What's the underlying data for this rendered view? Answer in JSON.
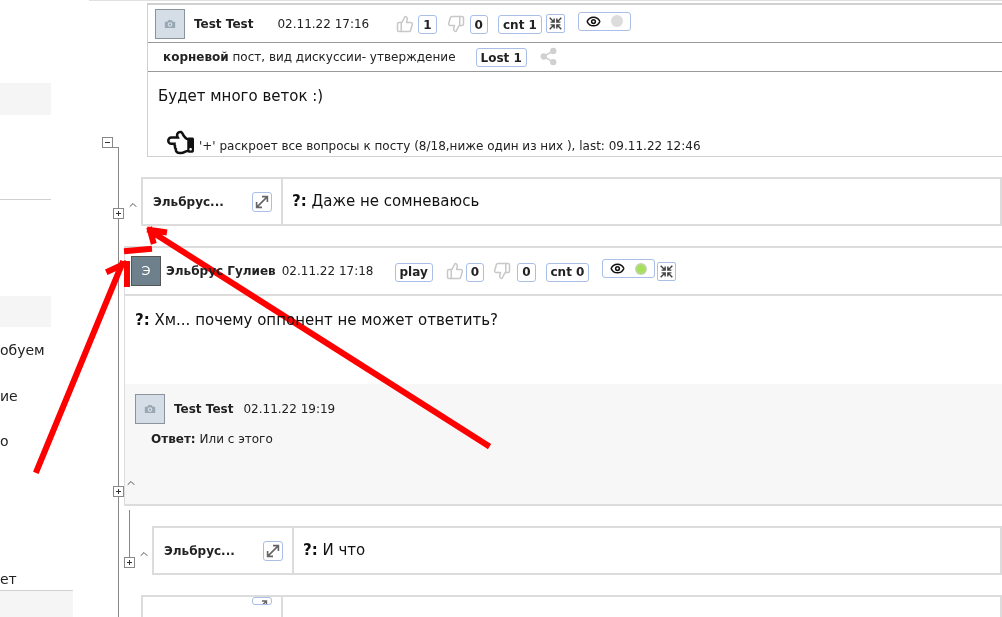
{
  "sidebar_fragments": [
    {
      "text": "обуем"
    },
    {
      "text": "ие"
    },
    {
      "text": "о"
    },
    {
      "text": "ет"
    }
  ],
  "root_post": {
    "expanded": true,
    "author": "Test Test",
    "date": "02.11.22 17:16",
    "likes": "1",
    "dislikes": "0",
    "count": "cnt 1",
    "seen": false,
    "type_label": "корневой",
    "type_text": "пост, вид дискуссии- утверждение",
    "lost": "Lost 1",
    "body": "Будет много веток :)",
    "hint": "'+' раскроет все вопросы к посту (8/18,ниже один из них ), last: 09.11.22 12:46"
  },
  "thread": [
    {
      "kind": "collapsed",
      "expanded": false,
      "author": "Эльбрус...",
      "prefix": "?:",
      "text": "Даже не сомневаюсь"
    },
    {
      "kind": "post",
      "expanded": false,
      "avatar_letter": "Э",
      "author": "Эльбрус Гулиев",
      "date": "02.11.22 17:18",
      "play": "play",
      "likes": "0",
      "dislikes": "0",
      "count": "cnt 0",
      "seen": true,
      "prefix": "?:",
      "text": "Хм... почему оппонент не может ответить?",
      "replies": [
        {
          "author": "Test Test",
          "date": "02.11.22 19:19",
          "prefix": "Ответ:",
          "text": "Или с этого"
        }
      ],
      "children": [
        {
          "kind": "collapsed",
          "expanded": false,
          "author": "Эльбрус...",
          "prefix": "?:",
          "text": "И что"
        }
      ]
    },
    {
      "kind": "stub"
    }
  ]
}
